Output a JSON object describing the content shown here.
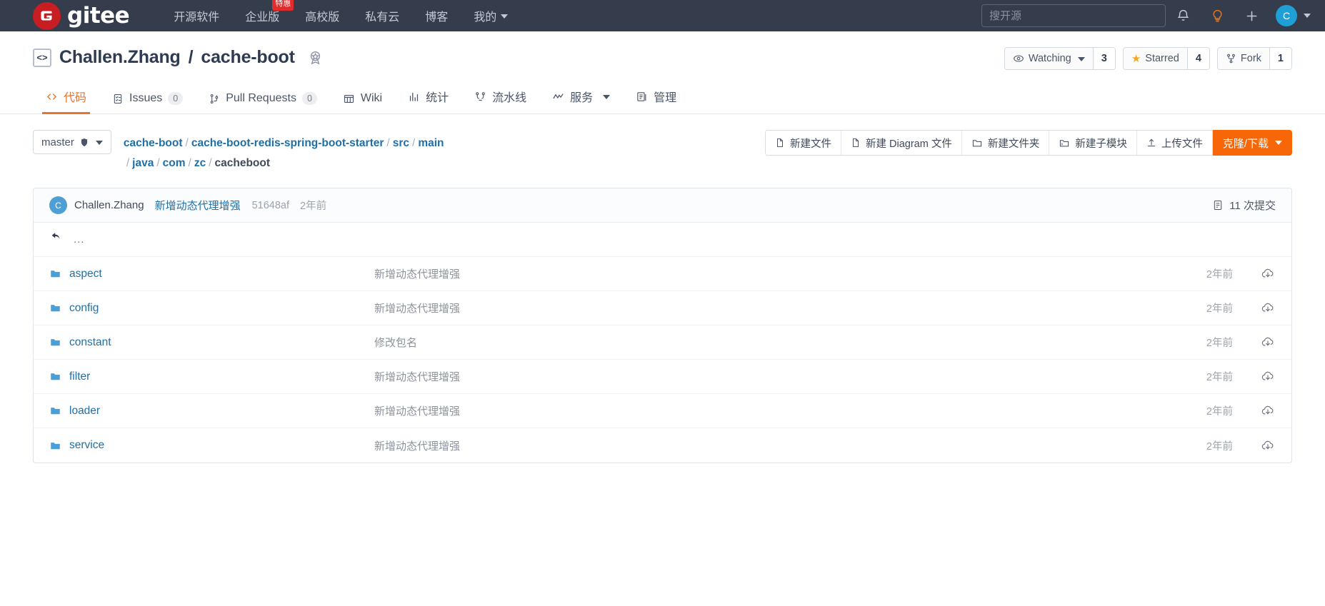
{
  "topnav": {
    "logo_text": "gitee",
    "items": [
      {
        "label": "开源软件",
        "badge": null,
        "caret": false
      },
      {
        "label": "企业版",
        "badge": "特惠",
        "caret": false
      },
      {
        "label": "高校版",
        "badge": null,
        "caret": false
      },
      {
        "label": "私有云",
        "badge": null,
        "caret": false
      },
      {
        "label": "博客",
        "badge": null,
        "caret": false
      },
      {
        "label": "我的",
        "badge": null,
        "caret": true
      }
    ],
    "search_placeholder": "搜开源",
    "icons": [
      "bell-icon",
      "lightbulb-icon",
      "plus-icon"
    ],
    "avatar_letter": "C",
    "accent_red": "#c71d23",
    "lightbulb_color": "#f0730a"
  },
  "repo": {
    "owner": "Challen.Zhang",
    "separator": "/",
    "name": "cache-boot",
    "actions": {
      "watching_label": "Watching",
      "watching_count": "3",
      "starred_label": "Starred",
      "starred_count": "4",
      "fork_label": "Fork",
      "fork_count": "1"
    }
  },
  "tabs": [
    {
      "label": "代码",
      "count": null,
      "active": true,
      "icon": "code-icon",
      "caret": false
    },
    {
      "label": "Issues",
      "count": "0",
      "active": false,
      "icon": "issue-icon",
      "caret": false
    },
    {
      "label": "Pull Requests",
      "count": "0",
      "active": false,
      "icon": "pr-icon",
      "caret": false
    },
    {
      "label": "Wiki",
      "count": null,
      "active": false,
      "icon": "wiki-icon",
      "caret": false
    },
    {
      "label": "统计",
      "count": null,
      "active": false,
      "icon": "stats-icon",
      "caret": false
    },
    {
      "label": "流水线",
      "count": null,
      "active": false,
      "icon": "pipeline-icon",
      "caret": false
    },
    {
      "label": "服务",
      "count": null,
      "active": false,
      "icon": "service-icon",
      "caret": true
    },
    {
      "label": "管理",
      "count": null,
      "active": false,
      "icon": "manage-icon",
      "caret": false
    }
  ],
  "toolbar": {
    "branch": "master",
    "breadcrumb_line1": [
      {
        "text": "cache-boot",
        "link": true
      },
      {
        "text": "cache-boot-redis-spring-boot-starter",
        "link": true
      },
      {
        "text": "src",
        "link": true
      },
      {
        "text": "main",
        "link": true
      }
    ],
    "breadcrumb_line2": [
      {
        "text": "java",
        "link": true
      },
      {
        "text": "com",
        "link": true
      },
      {
        "text": "zc",
        "link": true
      },
      {
        "text": "cacheboot",
        "link": false
      }
    ],
    "buttons": [
      {
        "label": "新建文件",
        "icon": "new-file-icon"
      },
      {
        "label": "新建 Diagram 文件",
        "icon": "new-diagram-icon"
      },
      {
        "label": "新建文件夹",
        "icon": "new-folder-icon"
      },
      {
        "label": "新建子模块",
        "icon": "new-submodule-icon"
      },
      {
        "label": "上传文件",
        "icon": "upload-icon"
      }
    ],
    "clone_label": "克隆/下载",
    "clone_color": "#f76707"
  },
  "commit": {
    "avatar_letter": "C",
    "author": "Challen.Zhang",
    "message": "新增动态代理增强",
    "sha": "51648af",
    "time": "2年前",
    "commits_label": "11 次提交"
  },
  "files": {
    "up_dir": "...",
    "rows": [
      {
        "name": "aspect",
        "message": "新增动态代理增强",
        "time": "2年前"
      },
      {
        "name": "config",
        "message": "新增动态代理增强",
        "time": "2年前"
      },
      {
        "name": "constant",
        "message": "修改包名",
        "time": "2年前"
      },
      {
        "name": "filter",
        "message": "新增动态代理增强",
        "time": "2年前"
      },
      {
        "name": "loader",
        "message": "新增动态代理增强",
        "time": "2年前"
      },
      {
        "name": "service",
        "message": "新增动态代理增强",
        "time": "2年前"
      }
    ]
  }
}
